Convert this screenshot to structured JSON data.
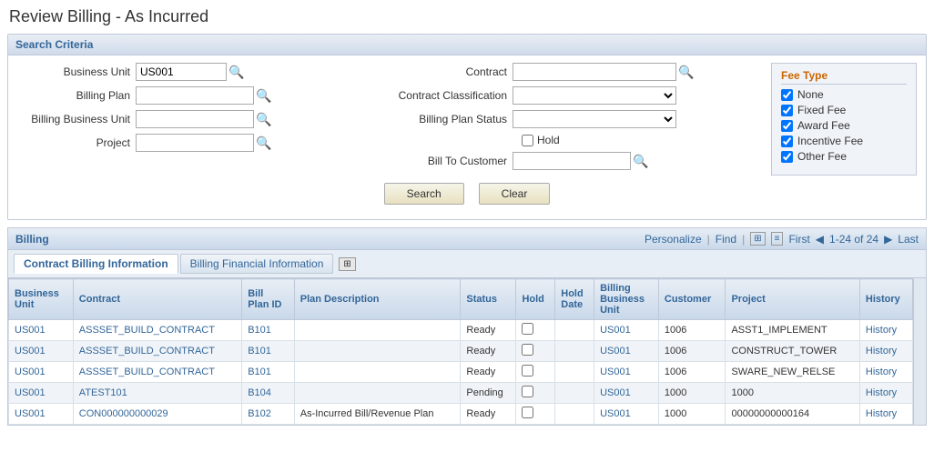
{
  "page": {
    "title": "Review Billing - As Incurred"
  },
  "searchCriteria": {
    "panelLabel": "Search Criteria",
    "fields": {
      "businessUnit": {
        "label": "Business Unit",
        "value": "US001"
      },
      "billingPlan": {
        "label": "Billing Plan",
        "value": ""
      },
      "billingBusinessUnit": {
        "label": "Billing Business Unit",
        "value": ""
      },
      "project": {
        "label": "Project",
        "value": ""
      },
      "contract": {
        "label": "Contract",
        "value": ""
      },
      "contractClassification": {
        "label": "Contract Classification",
        "value": ""
      },
      "billingPlanStatus": {
        "label": "Billing Plan Status",
        "value": ""
      },
      "hold": {
        "label": "Hold",
        "checked": false
      },
      "billToCustomer": {
        "label": "Bill To Customer",
        "value": ""
      }
    },
    "buttons": {
      "search": "Search",
      "clear": "Clear"
    },
    "feeType": {
      "title": "Fee Type",
      "items": [
        {
          "label": "None",
          "checked": true
        },
        {
          "label": "Fixed Fee",
          "checked": true
        },
        {
          "label": "Award Fee",
          "checked": true
        },
        {
          "label": "Incentive Fee",
          "checked": true
        },
        {
          "label": "Other Fee",
          "checked": true
        }
      ]
    }
  },
  "results": {
    "title": "Billing",
    "nav": {
      "personalize": "Personalize",
      "find": "Find",
      "range": "1-24 of 24",
      "first": "First",
      "last": "Last"
    },
    "tabs": [
      {
        "label": "Contract Billing Information",
        "active": true
      },
      {
        "label": "Billing Financial Information",
        "active": false
      }
    ],
    "columns": [
      "Business Unit",
      "Contract",
      "Bill Plan ID",
      "Plan Description",
      "Status",
      "Hold",
      "Hold Date",
      "Billing Business Unit",
      "Customer",
      "Project",
      "History"
    ],
    "rows": [
      {
        "businessUnit": "US001",
        "contract": "ASSSET_BUILD_CONTRACT",
        "billPlanId": "B101",
        "planDescription": "",
        "status": "Ready",
        "hold": false,
        "holdDate": "",
        "billingBusinessUnit": "US001",
        "customer": "1006",
        "project": "ASST1_IMPLEMENT",
        "history": "History"
      },
      {
        "businessUnit": "US001",
        "contract": "ASSSET_BUILD_CONTRACT",
        "billPlanId": "B101",
        "planDescription": "",
        "status": "Ready",
        "hold": false,
        "holdDate": "",
        "billingBusinessUnit": "US001",
        "customer": "1006",
        "project": "CONSTRUCT_TOWER",
        "history": "History"
      },
      {
        "businessUnit": "US001",
        "contract": "ASSSET_BUILD_CONTRACT",
        "billPlanId": "B101",
        "planDescription": "",
        "status": "Ready",
        "hold": false,
        "holdDate": "",
        "billingBusinessUnit": "US001",
        "customer": "1006",
        "project": "SWARE_NEW_RELSE",
        "history": "History"
      },
      {
        "businessUnit": "US001",
        "contract": "ATEST101",
        "billPlanId": "B104",
        "planDescription": "",
        "status": "Pending",
        "hold": false,
        "holdDate": "",
        "billingBusinessUnit": "US001",
        "customer": "1000",
        "project": "1000",
        "history": "History"
      },
      {
        "businessUnit": "US001",
        "contract": "CON000000000029",
        "billPlanId": "B102",
        "planDescription": "As-Incurred Bill/Revenue Plan",
        "status": "Ready",
        "hold": false,
        "holdDate": "",
        "billingBusinessUnit": "US001",
        "customer": "1000",
        "project": "00000000000164",
        "history": "History"
      }
    ]
  }
}
